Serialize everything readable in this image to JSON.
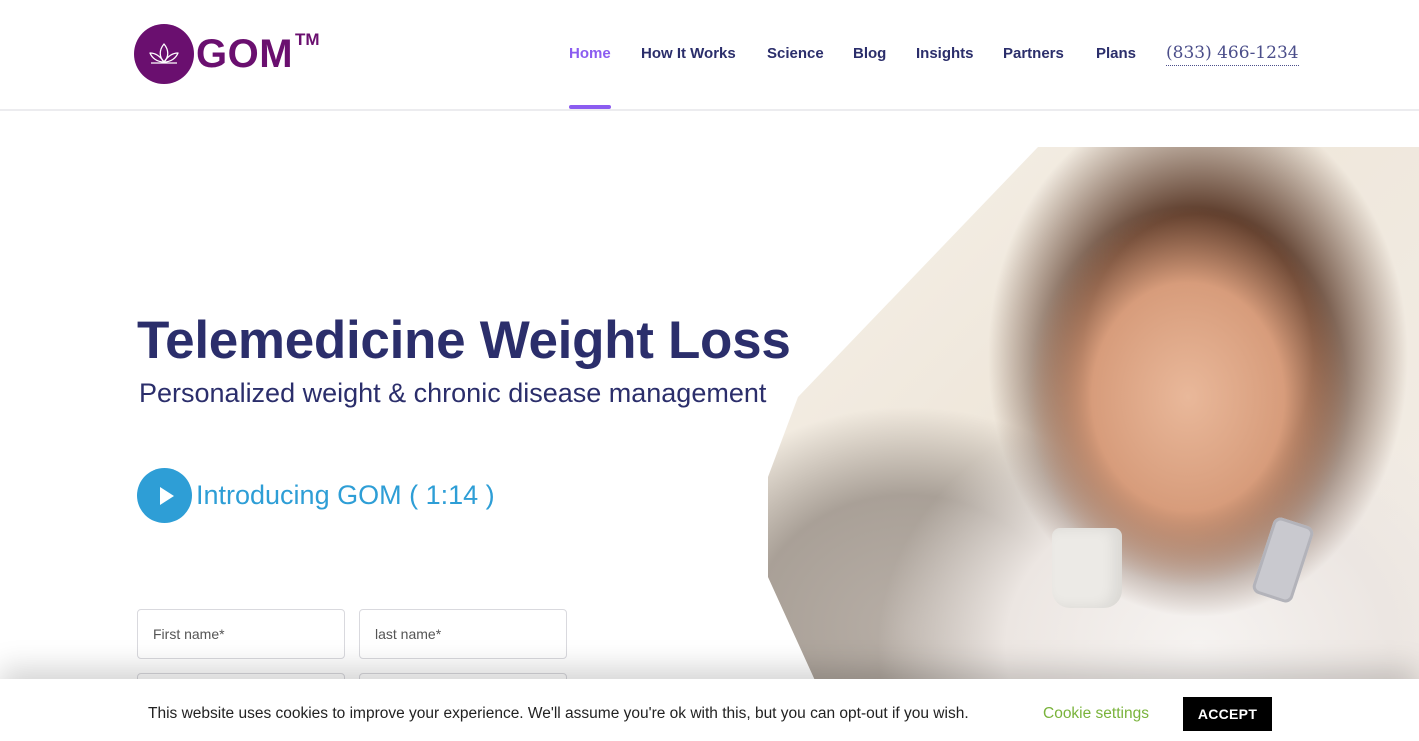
{
  "header": {
    "logo": {
      "text": "GOM",
      "tm": "TM",
      "brand_color": "#6a0f6f",
      "icon": "lotus-icon"
    },
    "nav": {
      "items": [
        {
          "label": "Home",
          "active": true
        },
        {
          "label": "How It Works",
          "active": false
        },
        {
          "label": "Science",
          "active": false
        },
        {
          "label": "Blog",
          "active": false
        },
        {
          "label": "Insights",
          "active": false
        },
        {
          "label": "Partners",
          "active": false
        },
        {
          "label": "Plans",
          "active": false
        }
      ],
      "phone": "(833) 466-1234",
      "active_color": "#8b5cf0",
      "text_color": "#2b2e6b"
    }
  },
  "hero": {
    "title": "Telemedicine Weight Loss",
    "subtitle": "Personalized weight & chronic disease management",
    "video": {
      "label": "Introducing GOM ( 1:14 )",
      "icon": "play-icon",
      "color": "#2e9ed6"
    },
    "image": "woman-on-couch-with-mug-and-phone"
  },
  "form": {
    "first_name": {
      "value": "",
      "placeholder": "First name*"
    },
    "last_name": {
      "value": "",
      "placeholder": "last name*"
    }
  },
  "cookie_bar": {
    "message": "This website uses cookies to improve your experience. We'll assume you're ok with this, but you can opt-out if you wish.",
    "settings_label": "Cookie settings",
    "accept_label": "ACCEPT",
    "settings_color": "#79b33b"
  }
}
